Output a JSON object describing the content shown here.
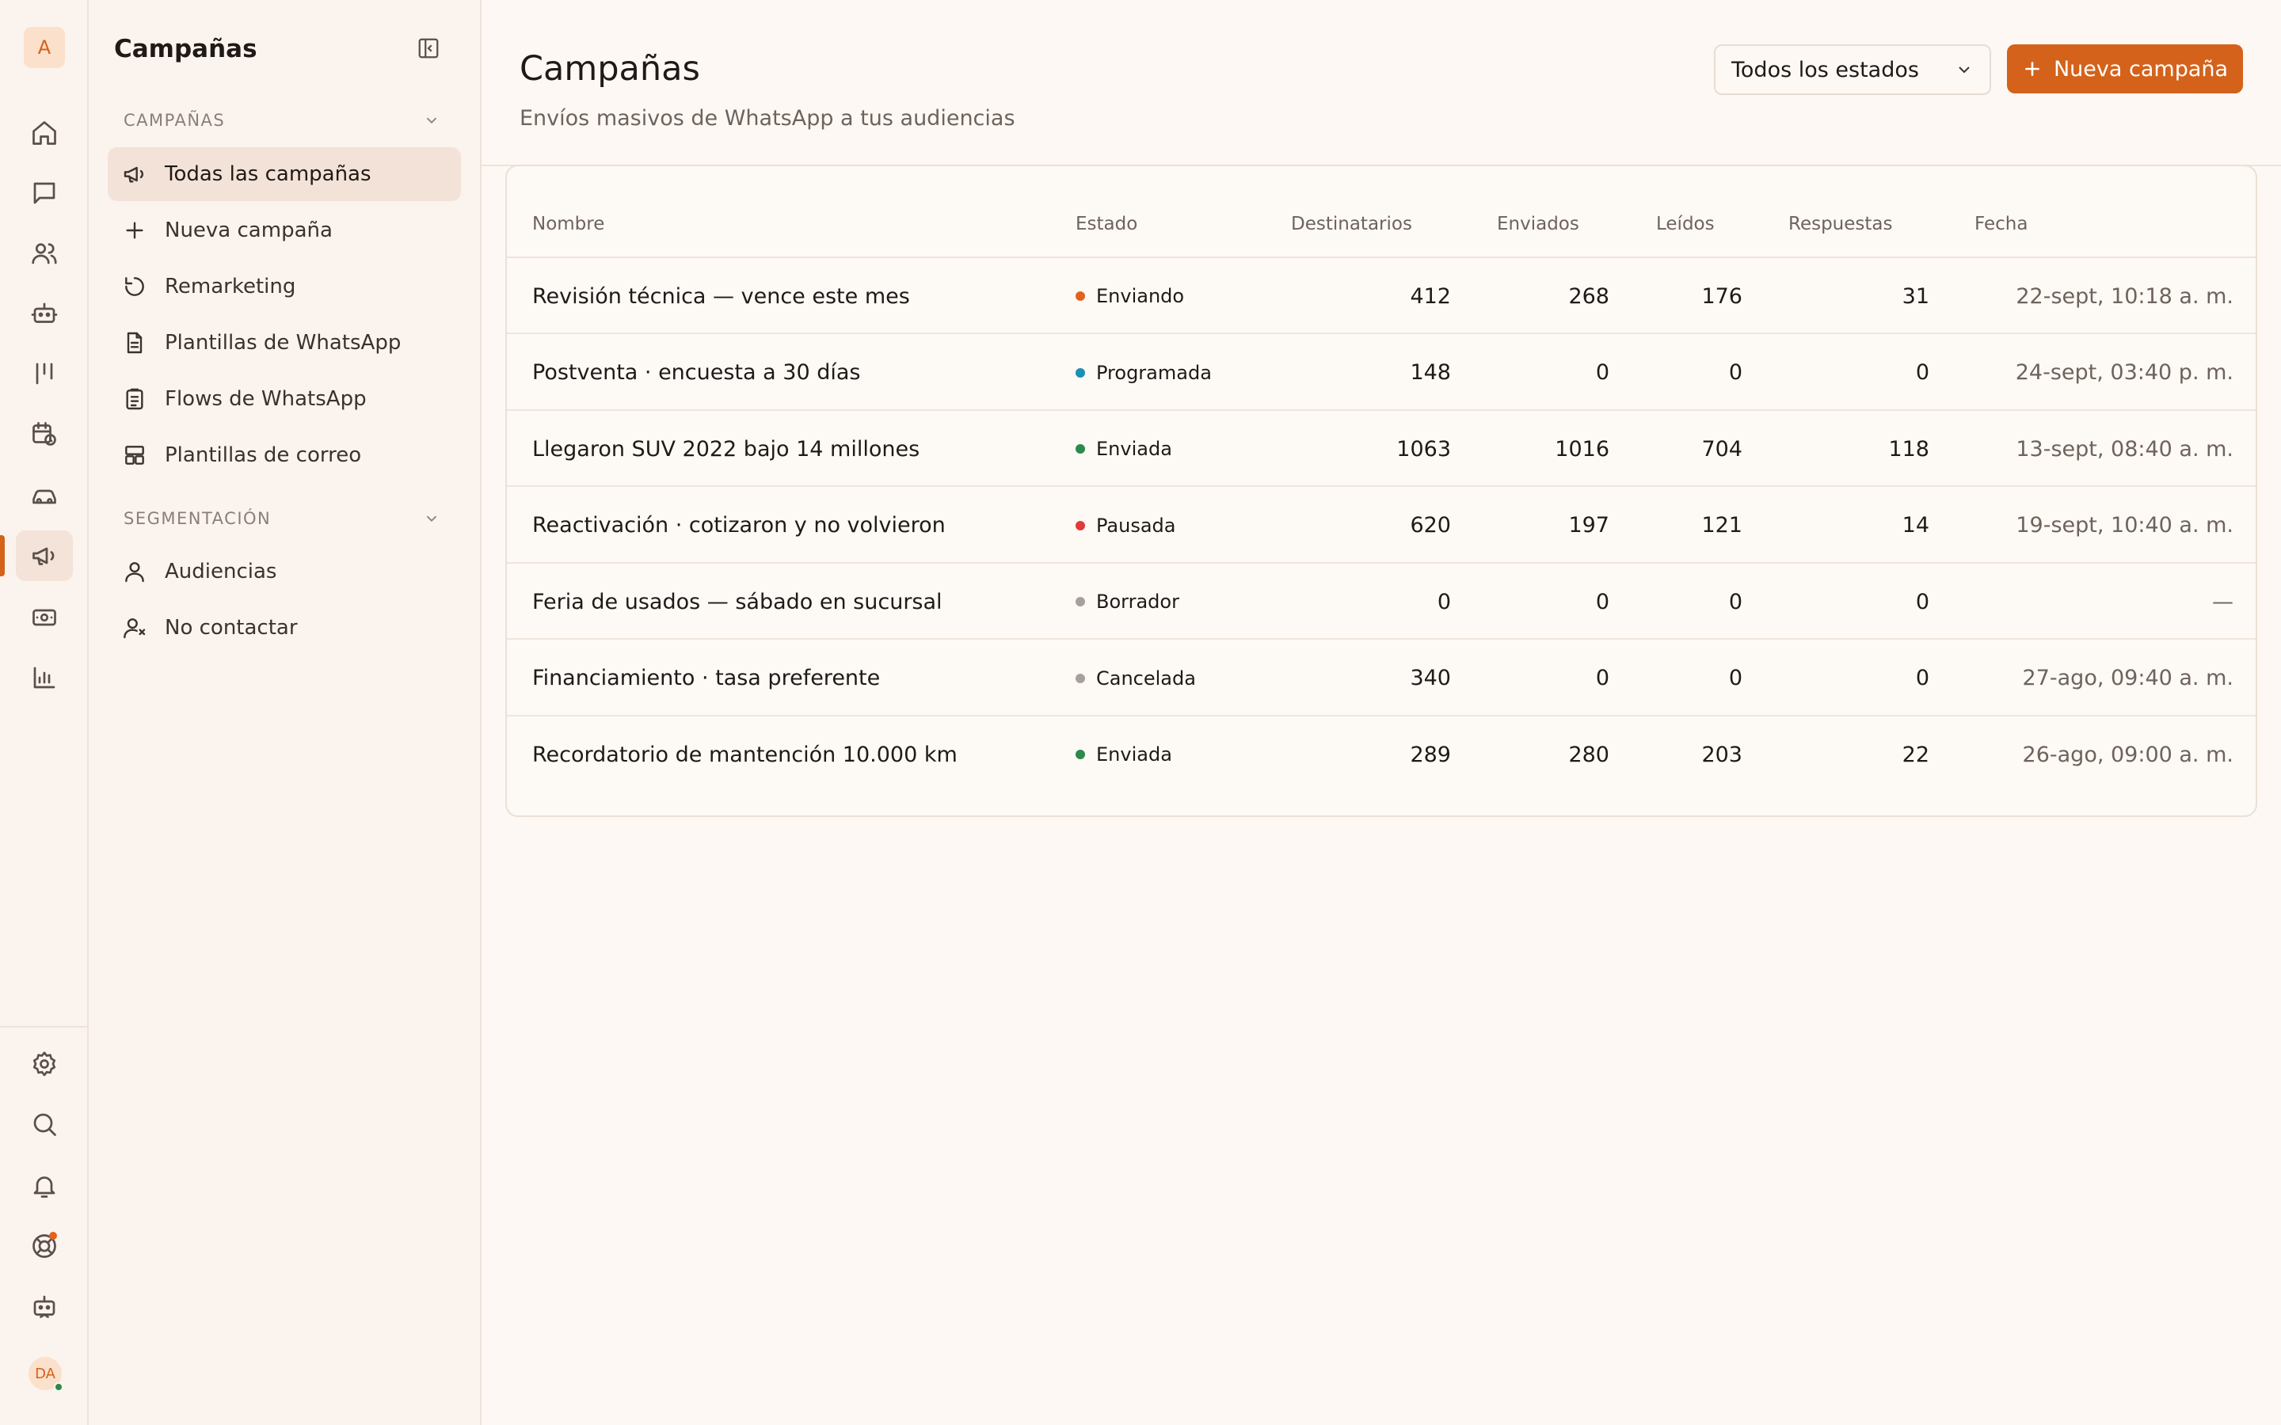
{
  "workspace": {
    "initial": "A"
  },
  "user": {
    "initials": "DA"
  },
  "sidebar": {
    "title": "Campañas",
    "sections": [
      {
        "label": "CAMPAÑAS",
        "items": [
          {
            "label": "Todas las campañas",
            "icon": "megaphone-icon",
            "active": true
          },
          {
            "label": "Nueva campaña",
            "icon": "plus-icon"
          },
          {
            "label": "Remarketing",
            "icon": "refresh-icon"
          },
          {
            "label": "Plantillas de WhatsApp",
            "icon": "document-icon"
          },
          {
            "label": "Flows de WhatsApp",
            "icon": "clipboard-icon"
          },
          {
            "label": "Plantillas de correo",
            "icon": "layout-icon"
          }
        ]
      },
      {
        "label": "SEGMENTACIÓN",
        "items": [
          {
            "label": "Audiencias",
            "icon": "user-icon"
          },
          {
            "label": "No contactar",
            "icon": "user-x-icon"
          }
        ]
      }
    ]
  },
  "header": {
    "title": "Campañas",
    "subtitle": "Envíos masivos de WhatsApp a tus audiencias",
    "status_filter": "Todos los estados",
    "new_button": "Nueva campaña"
  },
  "colors": {
    "accent": "#d4621a",
    "status_sending": "#e2621c",
    "status_scheduled": "#1d8fb5",
    "status_sent": "#2c8a4a",
    "status_paused": "#e03a3a",
    "status_draft": "#a8a09a",
    "status_cancelled": "#a8a09a"
  },
  "table": {
    "columns": [
      "Nombre",
      "Estado",
      "Destinatarios",
      "Enviados",
      "Leídos",
      "Respuestas",
      "Fecha"
    ],
    "rows": [
      {
        "name": "Revisión técnica — vence este mes",
        "status": "Enviando",
        "status_color": "#e2621c",
        "recipients": "412",
        "sent": "268",
        "read": "176",
        "replies": "31",
        "date": "22-sept, 10:18 a. m."
      },
      {
        "name": "Postventa · encuesta a 30 días",
        "status": "Programada",
        "status_color": "#1d8fb5",
        "recipients": "148",
        "sent": "0",
        "read": "0",
        "replies": "0",
        "date": "24-sept, 03:40 p. m."
      },
      {
        "name": "Llegaron SUV 2022 bajo 14 millones",
        "status": "Enviada",
        "status_color": "#2c8a4a",
        "recipients": "1063",
        "sent": "1016",
        "read": "704",
        "replies": "118",
        "date": "13-sept, 08:40 a. m."
      },
      {
        "name": "Reactivación · cotizaron y no volvieron",
        "status": "Pausada",
        "status_color": "#e03a3a",
        "recipients": "620",
        "sent": "197",
        "read": "121",
        "replies": "14",
        "date": "19-sept, 10:40 a. m."
      },
      {
        "name": "Feria de usados — sábado en sucursal",
        "status": "Borrador",
        "status_color": "#a8a09a",
        "recipients": "0",
        "sent": "0",
        "read": "0",
        "replies": "0",
        "date": "—"
      },
      {
        "name": "Financiamiento · tasa preferente",
        "status": "Cancelada",
        "status_color": "#a8a09a",
        "recipients": "340",
        "sent": "0",
        "read": "0",
        "replies": "0",
        "date": "27-ago, 09:40 a. m."
      },
      {
        "name": "Recordatorio de mantención 10.000 km",
        "status": "Enviada",
        "status_color": "#2c8a4a",
        "recipients": "289",
        "sent": "280",
        "read": "203",
        "replies": "22",
        "date": "26-ago, 09:00 a. m."
      }
    ]
  }
}
